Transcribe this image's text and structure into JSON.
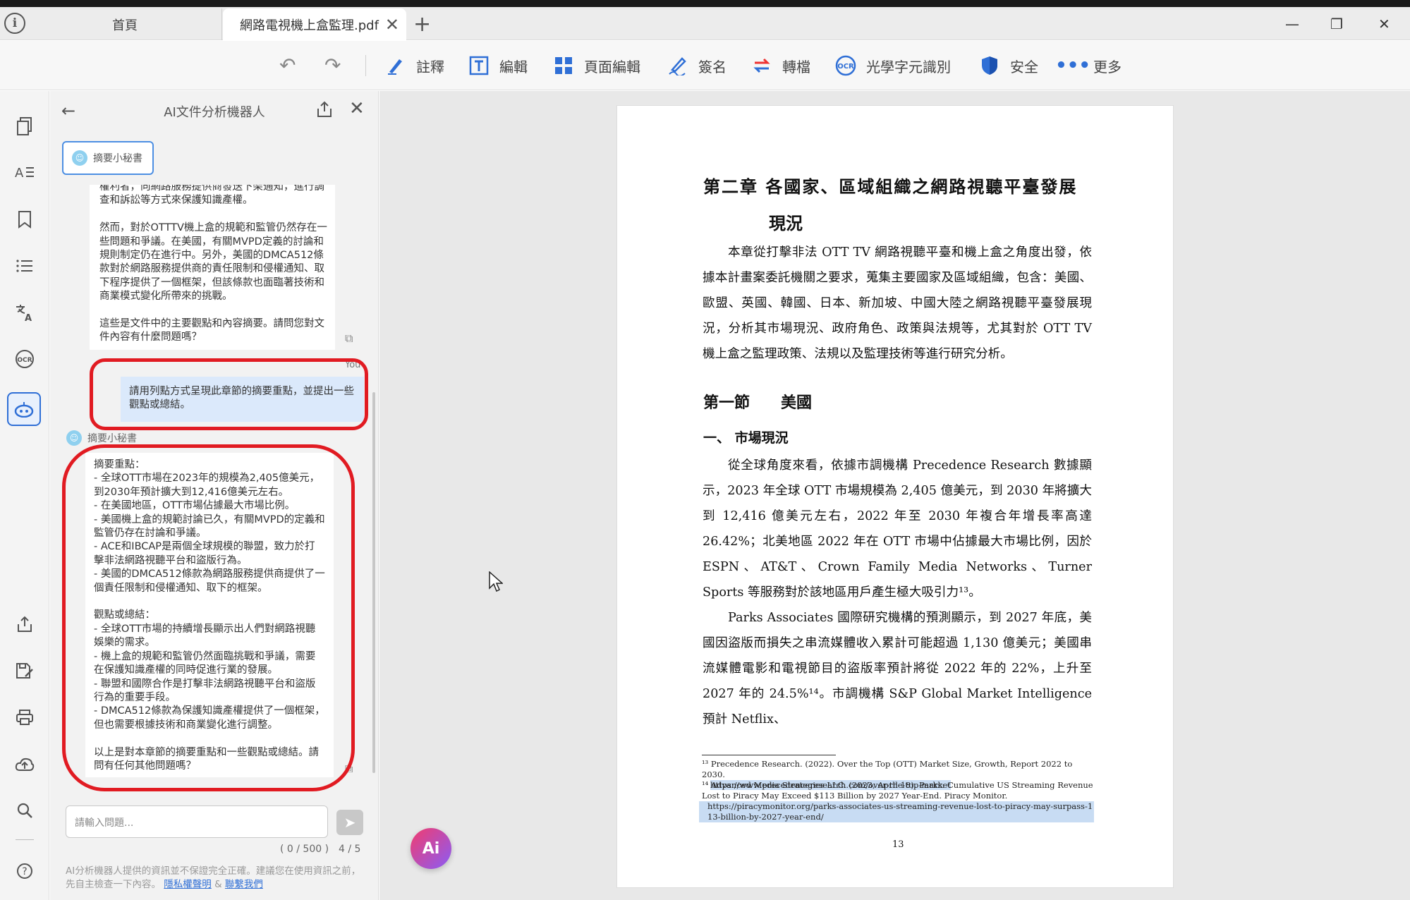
{
  "tabs": {
    "home": "首頁",
    "active": "網路電視機上盒監理.pdf"
  },
  "window": {
    "minimize": "—",
    "restore": "❐",
    "close": "✕"
  },
  "toolbar": {
    "annotate": "註釋",
    "edit": "編輯",
    "page_edit": "頁面編輯",
    "sign": "簽名",
    "convert": "轉檔",
    "ocr": "光學字元識別",
    "security": "安全",
    "more": "更多"
  },
  "panel": {
    "title": "AI文件分析機器人",
    "bot_name": "摘要小秘書",
    "you_label": "You",
    "msg_bot_1": "權利者，向網路服務提供商發送下架通知，進行調查和訴訟等方式來保護知識產權。\n\n然而，對於OTTTV機上盒的規範和監管仍然存在一些問題和爭議。在美國，有關MVPD定義的討論和規則制定仍在進行中。另外，美國的DMCA512條款對於網路服務提供商的責任限制和侵權通知、取下程序提供了一個框架，但該條款也面臨著技術和商業模式變化所帶來的挑戰。\n\n這些是文件中的主要觀點和內容摘要。請問您對文件內容有什麼問題嗎？",
    "msg_user": "請用列點方式呈現此章節的摘要重點，並提出一些觀點或總結。",
    "msg_bot_2": "摘要重點：\n- 全球OTT市場在2023年的規模為2,405億美元，到2030年預計擴大到12,416億美元左右。\n- 在美國地區，OTT市場佔據最大市場比例。\n- 美國機上盒的規範討論已久，有關MVPD的定義和監管仍存在討論和爭議。\n- ACE和IBCAP是兩個全球規模的聯盟，致力於打擊非法網路視聽平台和盜版行為。\n- 美國的DMCA512條款為網路服務提供商提供了一個責任限制和侵權通知、取下的框架。\n\n觀點或總結：\n- 全球OTT市場的持續增長顯示出人們對網路視聽娛樂的需求。\n- 機上盒的規範和監管仍然面臨挑戰和爭議，需要在保護知識產權的同時促進行業的發展。\n- 聯盟和國際合作是打擊非法網路視聽平台和盜版行為的重要手段。\n- DMCA512條款為保護知識產權提供了一個框架，但也需要根據技術和商業變化進行調整。\n\n以上是對本章節的摘要重點和一些觀點或總結。請問有任何其他問題嗎？",
    "input_placeholder": "請輸入問題...",
    "counter": "( 0 / 500 )",
    "pager": "4 / 5",
    "disclaimer": "AI分析機器人提供的資訊並不保證完全正確。建議您在使用資訊之前，先自主檢查一下內容。",
    "privacy_link": "隱私權聲明",
    "amp": "&",
    "contact_link": "聯繫我們"
  },
  "ai_fab": "Ai",
  "pdf": {
    "chapter_title_1": "第二章  各國家、區域組織之網路視聽平臺發展",
    "chapter_title_2": "現況",
    "para_1": "本章從打擊非法 OTT TV 網路視聽平臺和機上盒之角度出發，依據本計畫案委託機關之要求，蒐集主要國家及區域組織，包含：美國、歐盟、英國、韓國、日本、新加坡、中國大陸之網路視聽平臺發展現況，分析其市場現況、政府角色、政策與法規等，尤其對於 OTT TV 機上盒之監理政策、法規以及監理技術等進行研究分析。",
    "section_title": "第一節　　美國",
    "sub_title": "一、 市場現況",
    "para_2": "從全球角度來看，依據市調機構 Precedence Research 數據顯示，2023 年全球 OTT 市場規模為 2,405 億美元，到 2030 年將擴大到 12,416 億美元左右，2022 年至 2030 年複合年增長率高達 26.42%；北美地區 2022 年在 OTT 市場中佔據最大市場比例，因於 ESPN、AT&T、Crown Family Media Networks、Turner Sports 等服務對於該地區用戶產生極大吸引力¹³。",
    "para_3": "Parks Associates 國際研究機構的預測顯示，到 2027 年底，美國因盜版而損失之串流媒體收入累計可能超過 1,130 億美元；美國串流媒體電影和電視節目的盜版率預計將從 2022 年的 22%，上升至 2027 年的 24.5%¹⁴。市調機構 S&P Global Market Intelligence 預計 Netflix、",
    "fn13": "¹³ Precedence Research. (2022). Over the Top (OTT) Market Size, Growth, Report 2022 to 2030.",
    "fn13_url": "https://www.precedenceresearch.com/over-the-top-market",
    "fn14": "¹⁴ Advanced Media Strategies LLC. (2023, April 18). Parks: Cumulative US Streaming Revenue Lost to Piracy May Exceed $113 Billion by 2027 Year-End. Piracy Monitor.",
    "fn14_url": "https://piracymonitor.org/parks-associates-us-streaming-revenue-lost-to-piracy-may-surpass-113-billion-by-2027-year-end/",
    "page_number": "13"
  }
}
